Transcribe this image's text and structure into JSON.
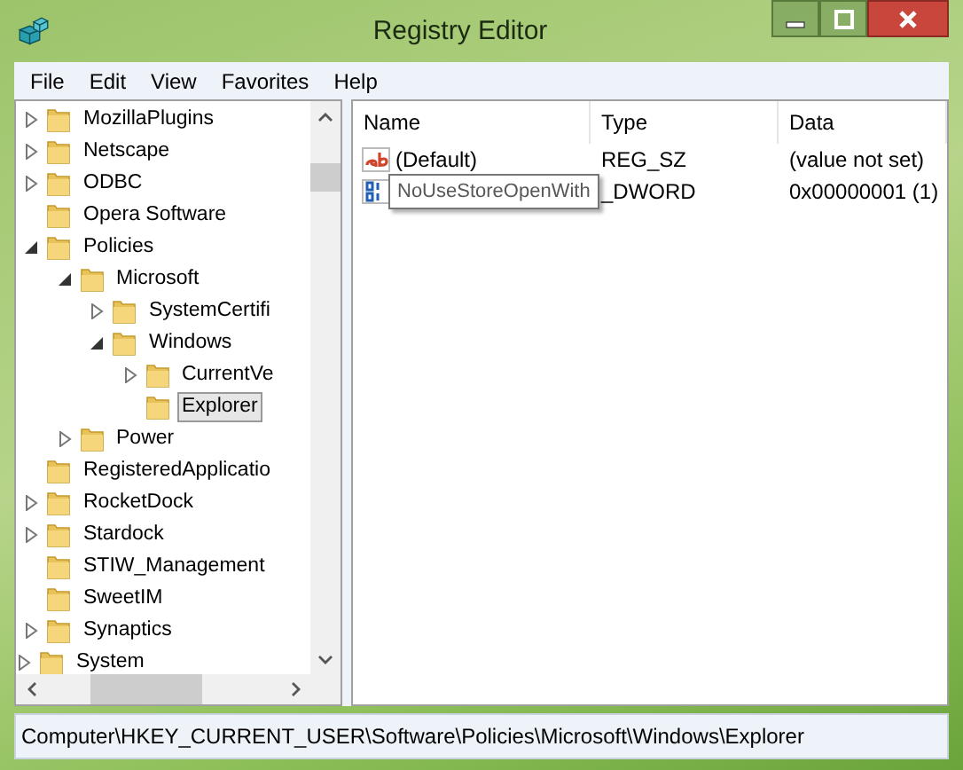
{
  "window": {
    "title": "Registry Editor"
  },
  "menu": [
    "File",
    "Edit",
    "View",
    "Favorites",
    "Help"
  ],
  "tree": {
    "items": [
      {
        "children": [
          {
            "label": "MozillaPlugins",
            "selected": false,
            "expanded": false
          },
          {
            "label": "Netscape",
            "selected": false,
            "expanded": false
          },
          {
            "label": "ODBC",
            "selected": false,
            "expanded": false
          },
          {
            "label": "Opera Software",
            "selected": false
          },
          {
            "label": "Policies",
            "selected": false,
            "expanded": true,
            "children": [
              {
                "label": "Microsoft",
                "selected": false,
                "expanded": true,
                "children": [
                  {
                    "label": "SystemCertifi",
                    "selected": false,
                    "expanded": false
                  },
                  {
                    "label": "Windows",
                    "selected": false,
                    "expanded": true,
                    "children": [
                      {
                        "label": "CurrentVe",
                        "selected": false,
                        "expanded": false
                      },
                      {
                        "label": "Explorer",
                        "selected": true
                      }
                    ]
                  }
                ]
              },
              {
                "label": "Power",
                "selected": false,
                "expanded": false
              }
            ]
          },
          {
            "label": "RegisteredApplicatio",
            "selected": false
          },
          {
            "label": "RocketDock",
            "selected": false,
            "expanded": false
          },
          {
            "label": "Stardock",
            "selected": false,
            "expanded": false
          },
          {
            "label": "STIW_Management",
            "selected": false
          },
          {
            "label": "SweetIM",
            "selected": false
          },
          {
            "label": "Synaptics",
            "selected": false,
            "expanded": false
          }
        ]
      },
      {
        "label": "System",
        "selected": false,
        "expanded": false
      }
    ]
  },
  "values": {
    "columns": [
      "Name",
      "Type",
      "Data"
    ],
    "rows": [
      {
        "kind": "string",
        "name": "(Default)",
        "type": "REG_SZ",
        "data": "(value not set)"
      },
      {
        "kind": "binary",
        "type": "_DWORD",
        "data": "0x00000001 (1)"
      }
    ],
    "tooltip": "NoUseStoreOpenWith"
  },
  "status_bar": "Computer\\HKEY_CURRENT_USER\\Software\\Policies\\Microsoft\\Windows\\Explorer"
}
